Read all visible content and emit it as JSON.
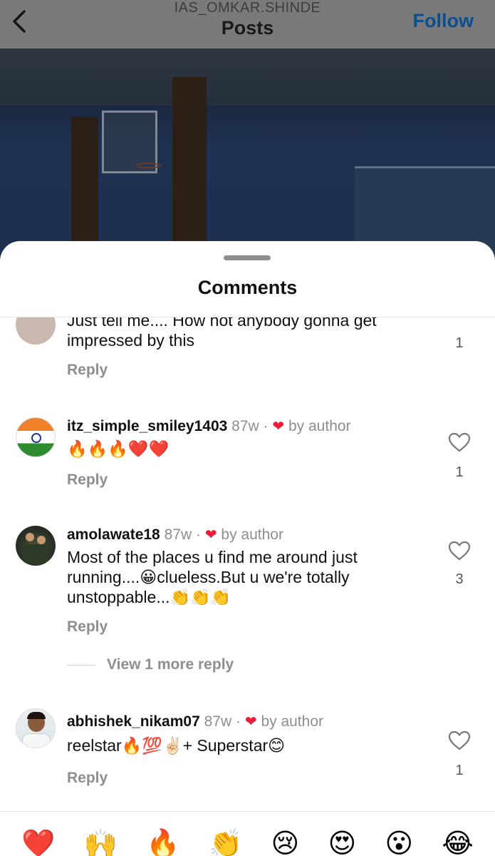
{
  "header": {
    "username": "IAS_OMKAR.SHINDE",
    "title": "Posts",
    "follow_label": "Follow"
  },
  "sheet": {
    "title": "Comments"
  },
  "comments": [
    {
      "text": "Just tell me.... How not anybody gonna get impressed by this",
      "reply_label": "Reply",
      "likes": "1"
    },
    {
      "username": "itz_simple_smiley1403",
      "time": "87w",
      "separator": "·",
      "heart": "❤",
      "by_author": "by author",
      "text": "🔥🔥🔥❤️❤️",
      "reply_label": "Reply",
      "likes": "1"
    },
    {
      "username": "amolawate18",
      "time": "87w",
      "separator": "·",
      "heart": "❤",
      "by_author": "by author",
      "text": "Most of the places u find me around just running....😀clueless.But u we're totally unstoppable...👏👏👏",
      "reply_label": "Reply",
      "likes": "3",
      "view_more": "View 1 more reply"
    },
    {
      "username": "abhishek_nikam07",
      "time": "87w",
      "separator": "·",
      "heart": "❤",
      "by_author": "by author",
      "text": "reelstar🔥💯✌🏻+ Superstar😊",
      "reply_label": "Reply",
      "likes": "1"
    }
  ],
  "emoji_bar": [
    "❤️",
    "🙌",
    "🔥",
    "👏",
    "😢",
    "😍",
    "😮",
    "😂"
  ],
  "colors": {
    "accent": "#0b4f8f",
    "heart": "#ed1c3a",
    "muted": "#8e8e8e"
  }
}
